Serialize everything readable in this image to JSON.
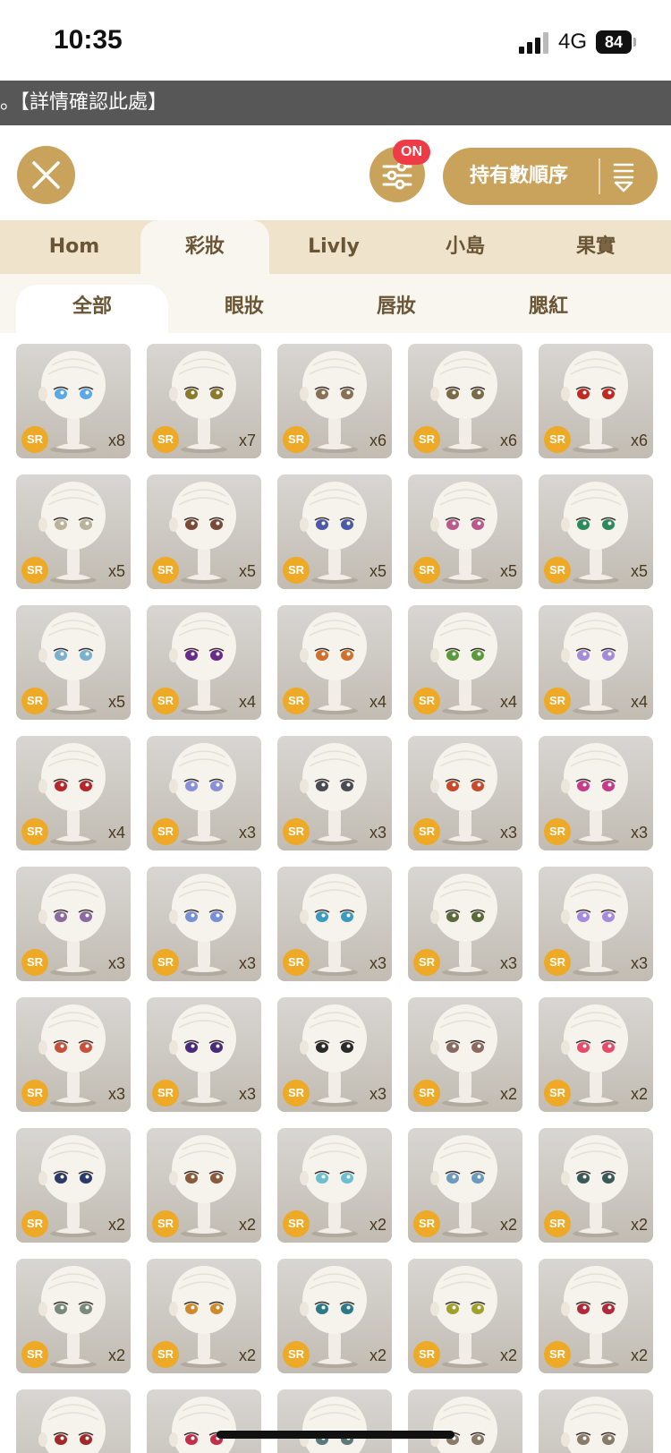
{
  "status_bar": {
    "time": "10:35",
    "network": "4G",
    "battery": "84"
  },
  "notice": {
    "text": "。【詳情確認此處】"
  },
  "header": {
    "filter_badge": "ON",
    "sort_label": "持有數順序"
  },
  "main_tabs": [
    {
      "label": "Hom",
      "active": false
    },
    {
      "label": "彩妝",
      "active": true
    },
    {
      "label": "Livly",
      "active": false
    },
    {
      "label": "小島",
      "active": false
    },
    {
      "label": "果實",
      "active": false
    }
  ],
  "sub_tabs": [
    {
      "label": "全部",
      "active": true
    },
    {
      "label": "眼妝",
      "active": false
    },
    {
      "label": "唇妝",
      "active": false
    },
    {
      "label": "腮紅",
      "active": false
    }
  ],
  "items": [
    {
      "rarity": "SR",
      "count": "x8",
      "eye_color": "#5aa9e6"
    },
    {
      "rarity": "SR",
      "count": "x7",
      "eye_color": "#8a7a2a"
    },
    {
      "rarity": "SR",
      "count": "x6",
      "eye_color": "#8a6f52"
    },
    {
      "rarity": "SR",
      "count": "x6",
      "eye_color": "#7a6a45"
    },
    {
      "rarity": "SR",
      "count": "x6",
      "eye_color": "#c02a24"
    },
    {
      "rarity": "SR",
      "count": "x5",
      "eye_color": "#b8b39a"
    },
    {
      "rarity": "SR",
      "count": "x5",
      "eye_color": "#7a4a36"
    },
    {
      "rarity": "SR",
      "count": "x5",
      "eye_color": "#4a5aa8"
    },
    {
      "rarity": "SR",
      "count": "x5",
      "eye_color": "#b85a8e"
    },
    {
      "rarity": "SR",
      "count": "x5",
      "eye_color": "#2a8a5a"
    },
    {
      "rarity": "SR",
      "count": "x5",
      "eye_color": "#7ab0d0"
    },
    {
      "rarity": "SR",
      "count": "x4",
      "eye_color": "#6a2a8a"
    },
    {
      "rarity": "SR",
      "count": "x4",
      "eye_color": "#d0702a"
    },
    {
      "rarity": "SR",
      "count": "x4",
      "eye_color": "#5a9a3a"
    },
    {
      "rarity": "SR",
      "count": "x4",
      "eye_color": "#a48ad8"
    },
    {
      "rarity": "SR",
      "count": "x4",
      "eye_color": "#b8262a"
    },
    {
      "rarity": "SR",
      "count": "x3",
      "eye_color": "#8a90d8"
    },
    {
      "rarity": "SR",
      "count": "x3",
      "eye_color": "#4a4a55"
    },
    {
      "rarity": "SR",
      "count": "x3",
      "eye_color": "#c84a2a"
    },
    {
      "rarity": "SR",
      "count": "x3",
      "eye_color": "#c83a8a"
    },
    {
      "rarity": "SR",
      "count": "x3",
      "eye_color": "#8a6aa0"
    },
    {
      "rarity": "SR",
      "count": "x3",
      "eye_color": "#7890d8"
    },
    {
      "rarity": "SR",
      "count": "x3",
      "eye_color": "#3a9ac0"
    },
    {
      "rarity": "SR",
      "count": "x3",
      "eye_color": "#5a6a3a"
    },
    {
      "rarity": "SR",
      "count": "x3",
      "eye_color": "#a68ae0"
    },
    {
      "rarity": "SR",
      "count": "x3",
      "eye_color": "#c8503a"
    },
    {
      "rarity": "SR",
      "count": "x3",
      "eye_color": "#4a2a7a"
    },
    {
      "rarity": "SR",
      "count": "x3",
      "eye_color": "#2a2a2a"
    },
    {
      "rarity": "SR",
      "count": "x2",
      "eye_color": "#8a6a60"
    },
    {
      "rarity": "SR",
      "count": "x2",
      "eye_color": "#e84a6a"
    },
    {
      "rarity": "SR",
      "count": "x2",
      "eye_color": "#2a3a6a"
    },
    {
      "rarity": "SR",
      "count": "x2",
      "eye_color": "#8a5a3a"
    },
    {
      "rarity": "SR",
      "count": "x2",
      "eye_color": "#6ac0d0"
    },
    {
      "rarity": "SR",
      "count": "x2",
      "eye_color": "#6a9ac0"
    },
    {
      "rarity": "SR",
      "count": "x2",
      "eye_color": "#3a5a5a"
    },
    {
      "rarity": "SR",
      "count": "x2",
      "eye_color": "#7a8a7a"
    },
    {
      "rarity": "SR",
      "count": "x2",
      "eye_color": "#d08a2a"
    },
    {
      "rarity": "SR",
      "count": "x2",
      "eye_color": "#2a7a8a"
    },
    {
      "rarity": "SR",
      "count": "x2",
      "eye_color": "#a0a02a"
    },
    {
      "rarity": "SR",
      "count": "x2",
      "eye_color": "#b02a3a"
    },
    {
      "rarity": "",
      "count": "",
      "eye_color": "#a02a2a"
    },
    {
      "rarity": "",
      "count": "",
      "eye_color": "#c0304a"
    },
    {
      "rarity": "",
      "count": "",
      "eye_color": "#5a7a7a"
    },
    {
      "rarity": "",
      "count": "",
      "eye_color": "#8a7a6a"
    },
    {
      "rarity": "",
      "count": "",
      "eye_color": "#8a7a6a"
    }
  ],
  "colors": {
    "accent": "#c9a35c",
    "badge_red": "#ef3b45",
    "sr_badge": "#eea926",
    "tab_bar": "#efe3cb",
    "notice_bg": "#575757"
  }
}
